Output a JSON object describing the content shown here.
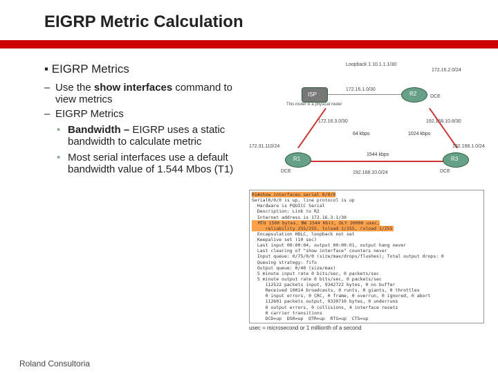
{
  "title": "EIGRP Metric Calculation",
  "section": "EIGRP Metrics",
  "bullets": {
    "b1_prefix": "Use the",
    "b1_bold": "show interfaces",
    "b1_suffix": "command to view metrics",
    "b2": "EIGRP Metrics",
    "s1_bold": "Bandwidth –",
    "s1_rest": "EIGRP uses a static bandwidth to calculate metric",
    "s2": "Most serial interfaces use a default bandwidth value of 1.544 Mbos (T1)"
  },
  "diagram": {
    "isp": "ISP",
    "r1": "R1",
    "r2": "R2",
    "r3": "R3",
    "loopback": "Loopback 1\n10.1.1.1/30",
    "n_17216": "172.16.2.0/24",
    "n_17216_10": "172.16.1.0/30",
    "n_17216_30": "172.16.3.0/30",
    "n_19216810": "192.168.10.8/30",
    "n_17231": "172.31.110/24",
    "n_19216810_4": "192.168.10.0/24",
    "n_19216810_1": "192.168.1.0/24",
    "bw64": "64 kbps",
    "bw1024": "1024 kbps",
    "bw1544": "1544 kbps",
    "dce": "DCE",
    "bgp_note": "This router is a\nphysical router"
  },
  "cli": {
    "cmd": "R1#show interfaces serial 0/0/0",
    "line1": "Serial0/0/0 is up, line protocol is up",
    "line2": "  Hardware is PQUICC Serial",
    "line3": "  Description: Link to R2",
    "line4": "  Internet address is 172.16.3.1/30",
    "highlight": "  MTU 1500 bytes, BW 1544 Kbit, DLY 20000 usec,\n     reliability 255/255, txload 1/255, rxload 1/255",
    "line5": "  Encapsulation HDLC, loopback not set",
    "line6": "  Keepalive set (10 sec)",
    "line7": "  Last input 00:00:04, output 00:00:01, output hang never",
    "line8": "  Last clearing of \"show interface\" counters never",
    "line9": "  Input queue: 0/75/0/0 (size/max/drops/flushes); Total output drops: 0",
    "line10": "  Queuing strategy: fifo",
    "line11": "  Output queue: 0/40 (size/max)",
    "line12": "  5 minute input rate 0 bits/sec, 0 packets/sec",
    "line13": "  5 minute output rate 0 bits/sec, 0 packets/sec",
    "line14": "     112522 packets input, 9342722 bytes, 0 no buffer",
    "line15": "     Received 10014 broadcasts, 0 runts, 0 giants, 0 throttles",
    "line16": "     0 input errors, 0 CRC, 0 frame, 0 overrun, 0 ignored, 0 abort",
    "line17": "     112601 packets output, 9330710 bytes, 0 underruns",
    "line18": "     0 output errors, 0 collisions, 4 interface resets",
    "line19": "     0 carrier transitions",
    "line20": "     DCD=up  DSR=up  DTR=up  RTS=up  CTS=up",
    "footnote": "usec = microsecond or 1 millionth of a second"
  },
  "footer": "Roland Consultoria"
}
